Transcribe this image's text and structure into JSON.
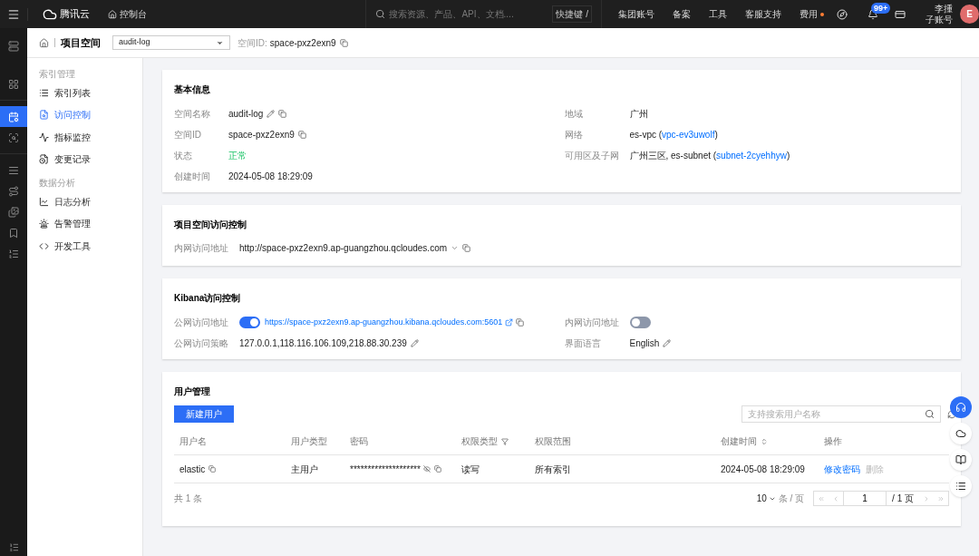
{
  "topbar": {
    "logo": "腾讯云",
    "console": "控制台",
    "search_placeholder": "搜索资源、产品、API、文档....",
    "shortcut": "快捷键 /",
    "links": [
      {
        "label": "集团账号",
        "dot": false
      },
      {
        "label": "备案",
        "dot": false
      },
      {
        "label": "工具",
        "dot": false
      },
      {
        "label": "客服支持",
        "dot": false
      },
      {
        "label": "费用",
        "dot": true
      }
    ],
    "notifications": "99+",
    "user": {
      "name": "李揰",
      "role": "子账号",
      "avatar": "E"
    }
  },
  "rail_items": [
    {
      "selected": false
    },
    {
      "selected": false
    },
    {
      "selected": true
    },
    {
      "selected": false
    },
    {
      "selected": false
    },
    {
      "selected": false
    },
    {
      "selected": false
    },
    {
      "selected": false
    },
    {
      "selected": false
    }
  ],
  "header": {
    "title": "项目空间",
    "space": "audit-log",
    "id_label": "空间ID:",
    "id_value": "space-pxz2exn9"
  },
  "sidebar": [
    {
      "title": "索引管理",
      "items": [
        {
          "label": "索引列表",
          "selected": false
        },
        {
          "label": "访问控制",
          "selected": true
        },
        {
          "label": "指标监控",
          "selected": false
        },
        {
          "label": "变更记录",
          "selected": false
        }
      ]
    },
    {
      "title": "数据分析",
      "items": [
        {
          "label": "日志分析",
          "selected": false
        },
        {
          "label": "告警管理",
          "selected": false
        },
        {
          "label": "开发工具",
          "selected": false
        }
      ]
    }
  ],
  "basic_info": {
    "title": "基本信息",
    "left": [
      {
        "label": "空间名称",
        "kind": "text",
        "value": "audit-log",
        "editable": true,
        "copyable": true
      },
      {
        "label": "空间ID",
        "kind": "text",
        "value": "space-pxz2exn9",
        "editable": false,
        "copyable": true
      },
      {
        "label": "状态",
        "kind": "status",
        "value": "正常",
        "editable": false,
        "copyable": false
      },
      {
        "label": "创建时间",
        "kind": "text",
        "value": "2024-05-08 18:29:09",
        "editable": false,
        "copyable": false
      }
    ],
    "right": [
      {
        "label": "地域",
        "kind": "text",
        "value": "广州",
        "editable": false,
        "copyable": false
      },
      {
        "label": "网络",
        "kind": "text",
        "value": "es-vpc (",
        "link": "vpc-ev3uwolf",
        "after": ")",
        "editable": false,
        "copyable": false
      },
      {
        "label": "可用区及子网",
        "kind": "text",
        "value": "广州三区, es-subnet (",
        "link": "subnet-2cyehhyw",
        "after": ")",
        "editable": false,
        "copyable": false
      }
    ]
  },
  "space_access": {
    "title": "项目空间访问控制",
    "label": "内网访问地址",
    "value": "http://space-pxz2exn9.ap-guangzhou.qcloudes.com"
  },
  "kibana": {
    "title": "Kibana访问控制",
    "public": {
      "label": "公网访问地址",
      "on": true,
      "link": "https://space-pxz2exn9.ap-guangzhou.kibana.qcloudes.com:5601"
    },
    "private": {
      "label": "内网访问地址",
      "on": false
    },
    "policy": {
      "label": "公网访问策略",
      "value": "127.0.0.1,118.116.106.109,218.88.30.239"
    },
    "language": {
      "label": "界面语言",
      "value": "English"
    }
  },
  "users": {
    "title": "用户管理",
    "new_button": "新建用户",
    "search_placeholder": "支持搜索用户名称",
    "columns": [
      {
        "label": "用户名",
        "filter": false,
        "sort": false
      },
      {
        "label": "用户类型",
        "filter": false,
        "sort": false
      },
      {
        "label": "密码",
        "filter": false,
        "sort": false
      },
      {
        "label": "权限类型",
        "filter": true,
        "sort": false
      },
      {
        "label": "权限范围",
        "filter": false,
        "sort": false
      },
      {
        "label": "创建时间",
        "filter": false,
        "sort": true
      },
      {
        "label": "操作",
        "filter": false,
        "sort": false
      }
    ],
    "rows": [
      {
        "name": "elastic",
        "type": "主用户",
        "password": "********************",
        "permission": "读写",
        "scope": "所有索引",
        "created": "2024-05-08 18:29:09",
        "actions": [
          {
            "label": "修改密码",
            "disabled": false
          },
          {
            "label": "删除",
            "disabled": true
          }
        ]
      }
    ],
    "total": "共 1 条",
    "page_size": "10",
    "per_page": "条 / 页",
    "page": "1",
    "pages": "/ 1 页"
  }
}
